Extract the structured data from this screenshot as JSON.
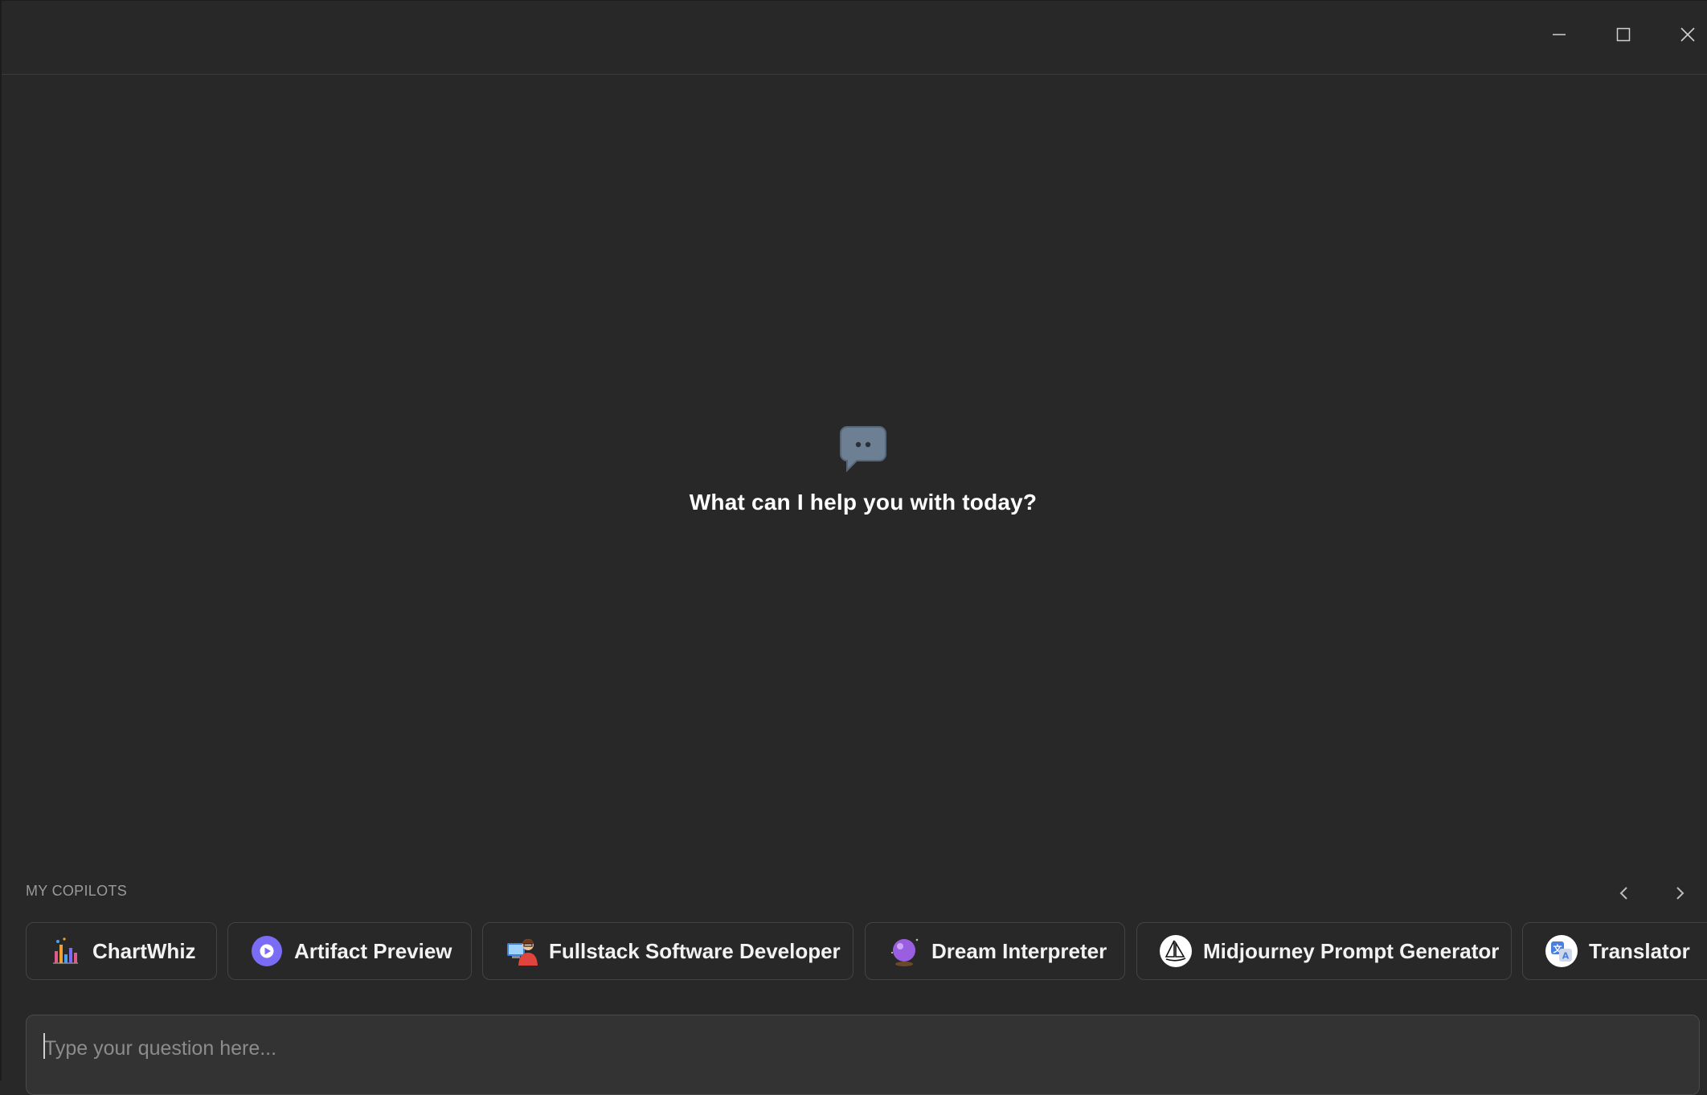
{
  "window_controls": {
    "minimize_icon": "minimize-icon",
    "maximize_icon": "maximize-icon",
    "close_icon": "close-icon"
  },
  "empty_state": {
    "icon": "chat-bubble-icon",
    "headline": "What can I help you with today?"
  },
  "copilots": {
    "section_label": "MY COPILOTS",
    "prev_icon": "chevron-left-icon",
    "next_icon": "chevron-right-icon",
    "items": [
      {
        "label": "ChartWhiz",
        "icon": "bar-chart-icon"
      },
      {
        "label": "Artifact Preview",
        "icon": "play-circle-icon"
      },
      {
        "label": "Fullstack Software Developer",
        "icon": "developer-icon"
      },
      {
        "label": "Dream Interpreter",
        "icon": "crystal-ball-icon"
      },
      {
        "label": "Midjourney Prompt Generator",
        "icon": "sailboat-icon"
      },
      {
        "label": "Translator",
        "icon": "translate-icon"
      }
    ]
  },
  "composer": {
    "value": "",
    "placeholder": "Type your question here..."
  },
  "colors": {
    "background": "#282828",
    "chip_border": "#444444",
    "text_primary": "#ffffff",
    "text_muted": "#9a9a9a",
    "accent_purple": "#7b6cf6"
  }
}
